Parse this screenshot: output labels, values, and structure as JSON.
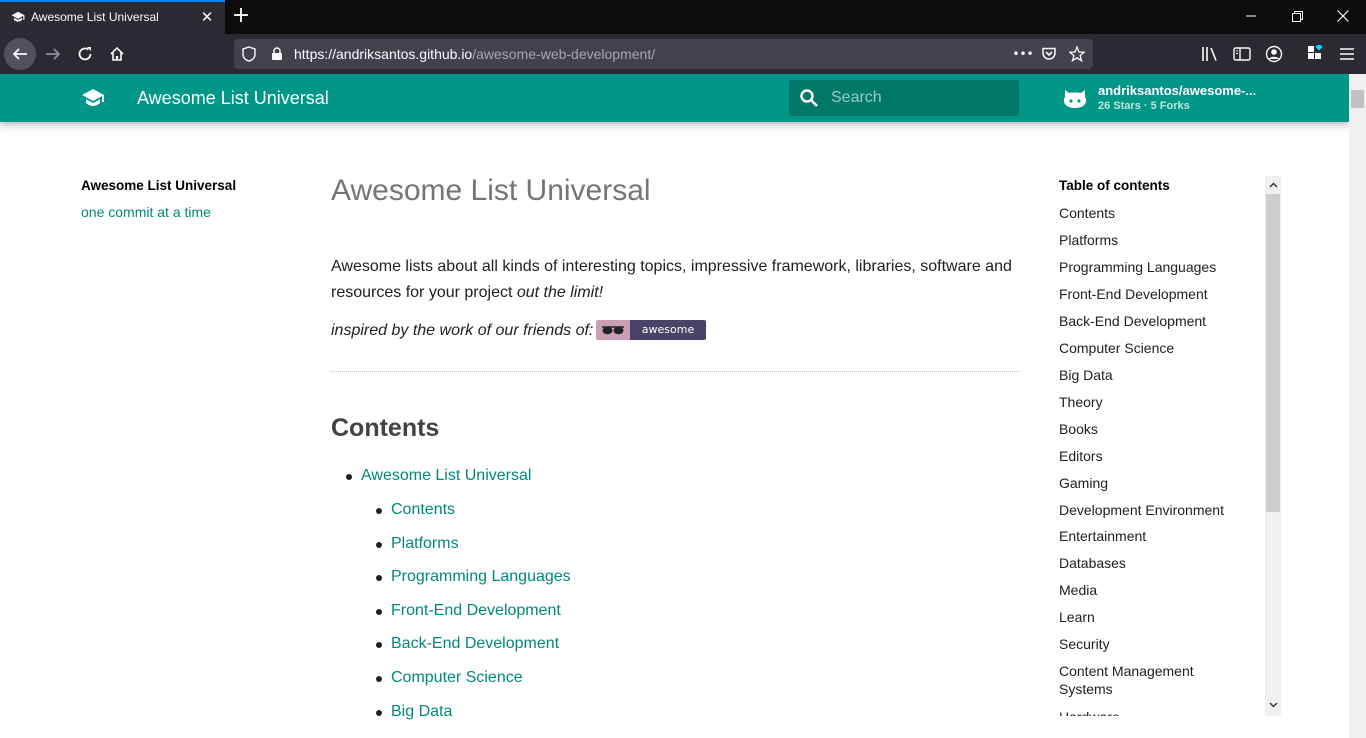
{
  "browser": {
    "tab_title": "Awesome List Universal",
    "tab_close": "✕",
    "new_tab": "+",
    "url_host": "https://andriksantos.github.io",
    "url_path": "/awesome-web-development/",
    "url_more": "•••"
  },
  "header": {
    "title": "Awesome List Universal",
    "search_placeholder": "Search",
    "repo_name": "andriksantos/awesome-...",
    "repo_facts": "26 Stars · 5 Forks",
    "color": "#009688"
  },
  "sidebar": {
    "title": "Awesome List Universal",
    "subtitle": "one commit at a time"
  },
  "article": {
    "h1": "Awesome List Universal",
    "para_main": "Awesome lists about all kinds of interesting topics, impressive framework, libraries, software and resources for your project ",
    "para_em": "out the limit!",
    "inspired": "inspired by the work of our friends of:",
    "badge_label": "awesome",
    "h2": "Contents",
    "list_top": "Awesome List Universal",
    "list_items": [
      "Contents",
      "Platforms",
      "Programming Languages",
      "Front-End Development",
      "Back-End Development",
      "Computer Science",
      "Big Data"
    ]
  },
  "toc": {
    "title": "Table of contents",
    "items": [
      "Contents",
      "Platforms",
      "Programming Languages",
      "Front-End Development",
      "Back-End Development",
      "Computer Science",
      "Big Data",
      "Theory",
      "Books",
      "Editors",
      "Gaming",
      "Development Environment",
      "Entertainment",
      "Databases",
      "Media",
      "Learn",
      "Security",
      "Content Management Systems",
      "Hardware"
    ]
  }
}
